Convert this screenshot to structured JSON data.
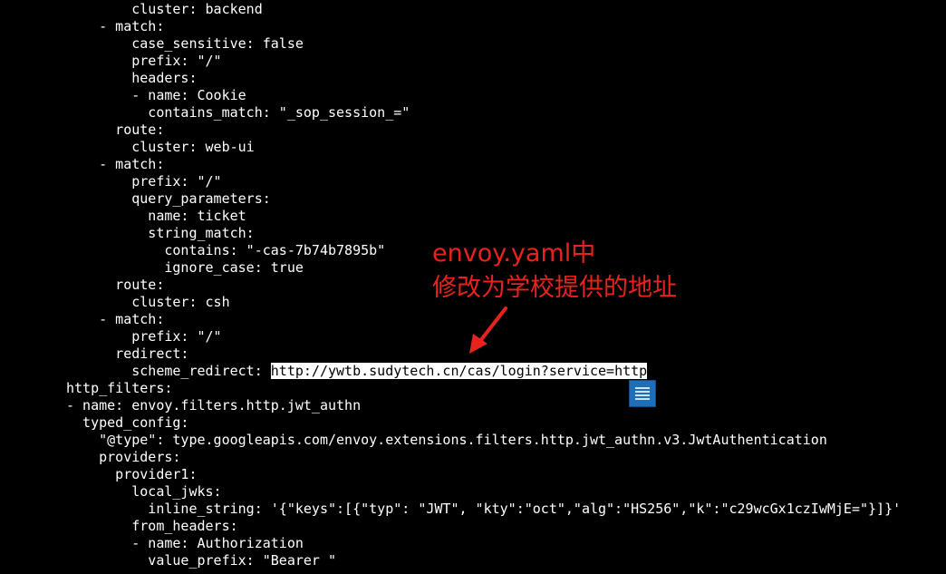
{
  "terminal": {
    "lines": [
      "        cluster: backend",
      "    - match:",
      "        case_sensitive: false",
      "        prefix: \"/\"",
      "        headers:",
      "        - name: Cookie",
      "          contains_match: \"_sop_session_=\"",
      "      route:",
      "        cluster: web-ui",
      "    - match:",
      "        prefix: \"/\"",
      "        query_parameters:",
      "          name: ticket",
      "          string_match:",
      "            contains: \"-cas-7b74b7895b\"",
      "            ignore_case: true",
      "      route:",
      "        cluster: csh",
      "    - match:",
      "        prefix: \"/\"",
      "      redirect:",
      "        scheme_redirect: ",
      "http_filters:",
      "- name: envoy.filters.http.jwt_authn",
      "  typed_config:",
      "    \"@type\": type.googleapis.com/envoy.extensions.filters.http.jwt_authn.v3.JwtAuthentication",
      "    providers:",
      "      provider1:",
      "        local_jwks:",
      "          inline_string: '{\"keys\":[{\"typ\": \"JWT\", \"kty\":\"oct\",\"alg\":\"HS256\",\"k\":\"c29wcGx1czIwMjE=\"}]}'",
      "        from_headers:",
      "        - name: Authorization",
      "          value_prefix: \"Bearer \""
    ],
    "selected_url": "http://ywtb.sudytech.cn/cas/login?service=http"
  },
  "annotation": {
    "line1": "envoy.yaml中",
    "line2": "修改为学校提供的地址",
    "color": "#e8231d"
  },
  "scroll_widget": {
    "icon": "list-icon",
    "color": "#1f6fb8"
  }
}
